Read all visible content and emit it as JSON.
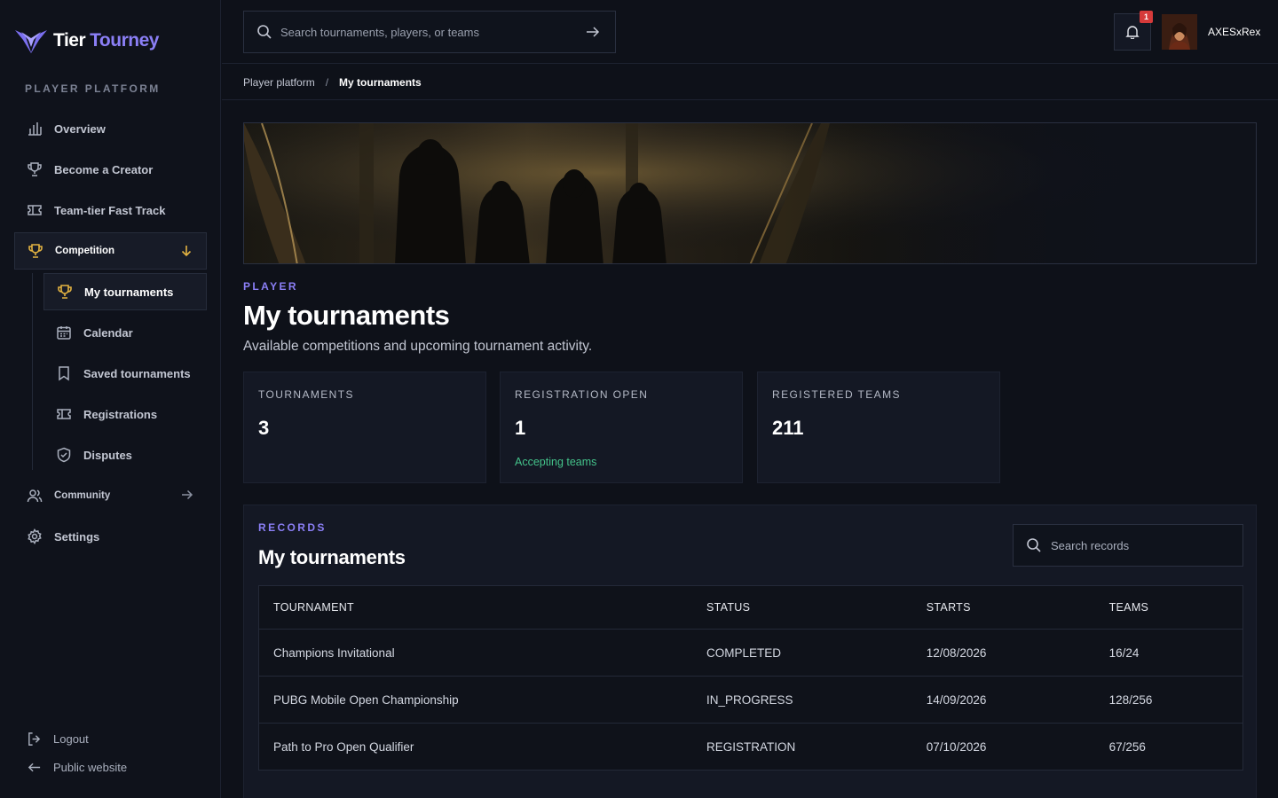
{
  "brand": {
    "name_part1": "Tier",
    "name_part2": "Tourney",
    "accent": "#8b7ff6"
  },
  "sidebar": {
    "section_label": "PLAYER PLATFORM",
    "items": [
      {
        "label": "Overview",
        "icon": "bar-chart-icon"
      },
      {
        "label": "Become a Creator",
        "icon": "trophy-icon"
      },
      {
        "label": "Team-tier Fast Track",
        "icon": "ticket-icon"
      },
      {
        "label": "Competition",
        "icon": "trophy-icon",
        "expanded": true
      },
      {
        "label": "Community",
        "icon": "users-icon"
      },
      {
        "label": "Settings",
        "icon": "gear-icon"
      }
    ],
    "sub_items": [
      {
        "label": "My tournaments",
        "icon": "trophy-icon",
        "active": true
      },
      {
        "label": "Calendar",
        "icon": "calendar-icon"
      },
      {
        "label": "Saved tournaments",
        "icon": "bookmark-icon"
      },
      {
        "label": "Registrations",
        "icon": "ticket-icon"
      },
      {
        "label": "Disputes",
        "icon": "shield-icon"
      }
    ],
    "footer": {
      "logout": "Logout",
      "public_website": "Public website"
    }
  },
  "topbar": {
    "search_placeholder": "Search tournaments, players, or teams",
    "notification_count": "1",
    "username": "AXESxRex"
  },
  "breadcrumb": {
    "parent": "Player platform",
    "separator": "/",
    "current": "My tournaments"
  },
  "header": {
    "eyebrow": "PLAYER",
    "title": "My tournaments",
    "subtitle": "Available competitions and upcoming tournament activity."
  },
  "stats": [
    {
      "label": "TOURNAMENTS",
      "value": "3",
      "note": ""
    },
    {
      "label": "REGISTRATION OPEN",
      "value": "1",
      "note": "Accepting teams"
    },
    {
      "label": "REGISTERED TEAMS",
      "value": "211",
      "note": ""
    }
  ],
  "records": {
    "eyebrow": "RECORDS",
    "title": "My tournaments",
    "search_placeholder": "Search records",
    "columns": [
      "TOURNAMENT",
      "STATUS",
      "STARTS",
      "TEAMS"
    ],
    "rows": [
      {
        "tournament": "Champions Invitational",
        "status": "COMPLETED",
        "starts": "12/08/2026",
        "teams": "16/24"
      },
      {
        "tournament": "PUBG Mobile Open Championship",
        "status": "IN_PROGRESS",
        "starts": "14/09/2026",
        "teams": "128/256"
      },
      {
        "tournament": "Path to Pro Open Qualifier",
        "status": "REGISTRATION",
        "starts": "07/10/2026",
        "teams": "67/256"
      }
    ]
  },
  "colors": {
    "success": "#44c28a",
    "badge": "#d63a3a",
    "background": "#0e1119",
    "card": "#141824"
  }
}
